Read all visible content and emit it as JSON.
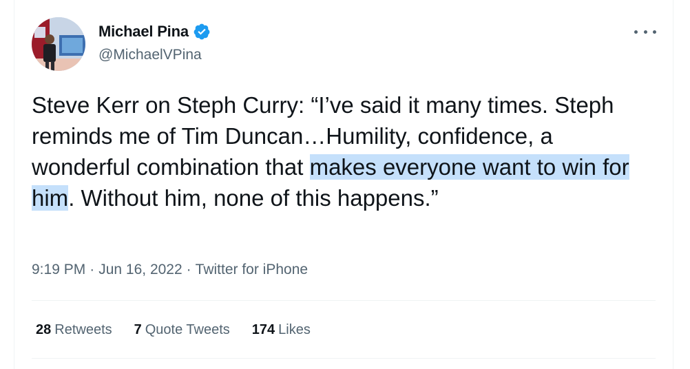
{
  "author": {
    "name": "Michael Pina",
    "handle": "@MichaelVPina",
    "verified": true
  },
  "tweet": {
    "text_before_highlight": "Steve Kerr on Steph Curry: “I’ve said it many times. Steph reminds me of Tim Duncan…Humility, confidence, a wonderful combination that ",
    "text_highlighted": "makes everyone want to win for him",
    "text_after_highlight": ". Without him, none of this happens.”",
    "time": "9:19 PM",
    "date": "Jun 16, 2022",
    "source": "Twitter for iPhone",
    "separator": "·"
  },
  "stats": {
    "retweets_count": "28",
    "retweets_label": "Retweets",
    "quotes_count": "7",
    "quotes_label": "Quote Tweets",
    "likes_count": "174",
    "likes_label": "Likes"
  },
  "icons": {
    "verified": "verified-badge-icon",
    "more": "more-options-icon"
  },
  "colors": {
    "verified_blue": "#1d9bf0",
    "text": "#0f1419",
    "secondary_text": "#536471",
    "highlight": "#c5e0fb",
    "divider": "#eff3f4"
  }
}
